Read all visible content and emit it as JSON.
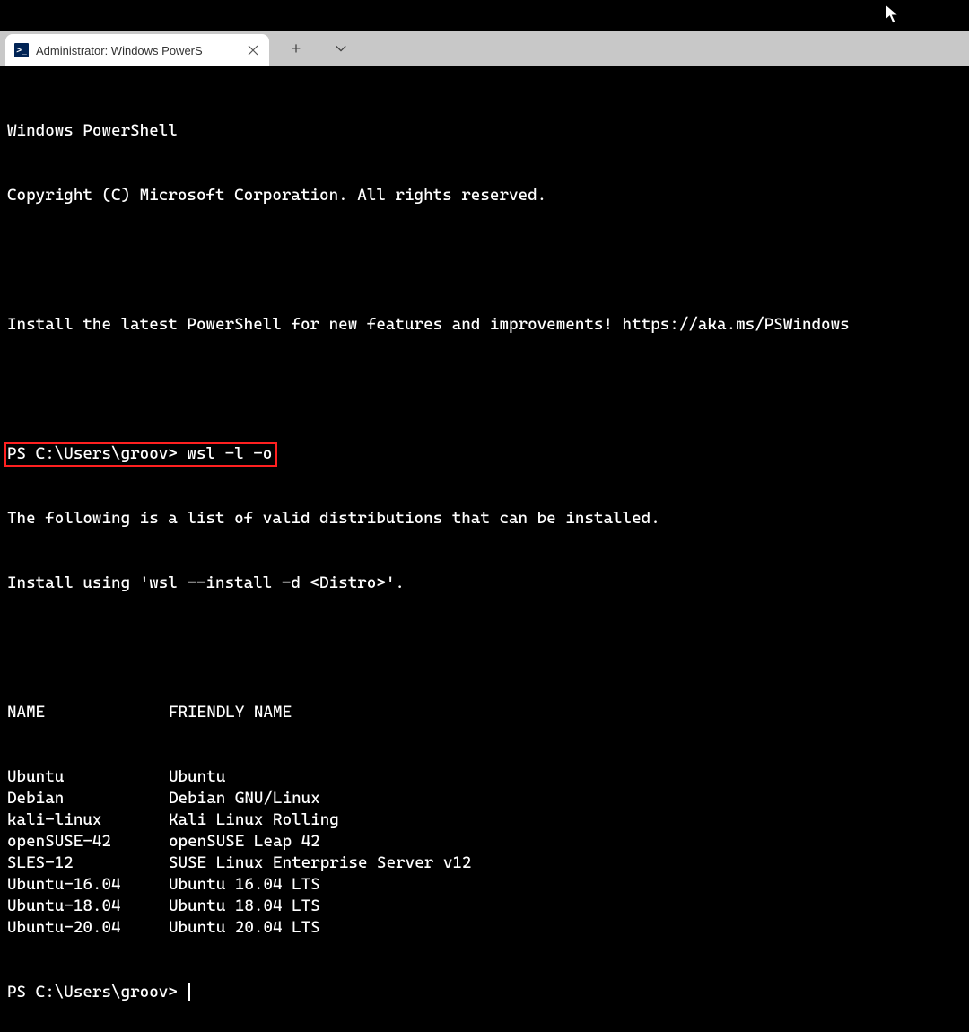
{
  "tabstrip": {
    "active_tab": {
      "icon_glyph": ">_",
      "title": "Administrator: Windows PowerS"
    }
  },
  "terminal": {
    "banner_line1": "Windows PowerShell",
    "banner_line2": "Copyright (C) Microsoft Corporation. All rights reserved.",
    "install_hint": "Install the latest PowerShell for new features and improvements! https://aka.ms/PSWindows",
    "prompt1_prefix": "PS C:\\Users\\groov> ",
    "prompt1_command": "wsl -l -o",
    "output_line1": "The following is a list of valid distributions that can be installed.",
    "output_line2": "Install using 'wsl --install -d <Distro>'.",
    "table_header_name": "NAME",
    "table_header_friendly": "FRIENDLY NAME",
    "rows": [
      {
        "name": "Ubuntu",
        "friendly": "Ubuntu"
      },
      {
        "name": "Debian",
        "friendly": "Debian GNU/Linux"
      },
      {
        "name": "kali-linux",
        "friendly": "Kali Linux Rolling"
      },
      {
        "name": "openSUSE-42",
        "friendly": "openSUSE Leap 42"
      },
      {
        "name": "SLES-12",
        "friendly": "SUSE Linux Enterprise Server v12"
      },
      {
        "name": "Ubuntu-16.04",
        "friendly": "Ubuntu 16.04 LTS"
      },
      {
        "name": "Ubuntu-18.04",
        "friendly": "Ubuntu 18.04 LTS"
      },
      {
        "name": "Ubuntu-20.04",
        "friendly": "Ubuntu 20.04 LTS"
      }
    ],
    "prompt2": "PS C:\\Users\\groov> "
  }
}
